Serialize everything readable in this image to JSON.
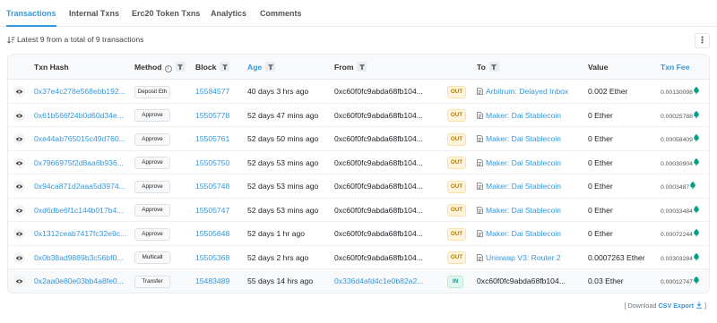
{
  "tabs": [
    {
      "label": "Transactions",
      "active": true
    },
    {
      "label": "Internal Txns"
    },
    {
      "label": "Erc20 Token Txns"
    },
    {
      "label": "Analytics"
    },
    {
      "label": "Comments"
    }
  ],
  "summary": "Latest 9 from a total of 9 transactions",
  "more_icon": "⋮",
  "columns": {
    "txn_hash": "Txn Hash",
    "method": "Method",
    "block": "Block",
    "age": "Age",
    "from": "From",
    "to": "To",
    "value": "Value",
    "txn_fee": "Txn Fee"
  },
  "rows": [
    {
      "hash": "0x37e4c278e568ebb192...",
      "method": "Deposit Eth",
      "block": "15584577",
      "age": "40 days 3 hrs ago",
      "from": "0xc60f0fc9abda68fb104...",
      "direction": "OUT",
      "to": "Arbitrum: Delayed Inbox",
      "to_is_contract": true,
      "value": "0.002 Ether",
      "fee": "0.00130098"
    },
    {
      "hash": "0x61b566f24b0d60d34e...",
      "method": "Approve",
      "block": "15505778",
      "age": "52 days 47 mins ago",
      "from": "0xc60f0fc9abda68fb104...",
      "direction": "OUT",
      "to": "Maker: Dai Stablecoin",
      "to_is_contract": true,
      "value": "0 Ether",
      "fee": "0.00025788"
    },
    {
      "hash": "0xe44ab765015c49d760...",
      "method": "Approve",
      "block": "15505761",
      "age": "52 days 50 mins ago",
      "from": "0xc60f0fc9abda68fb104...",
      "direction": "OUT",
      "to": "Maker: Dai Stablecoin",
      "to_is_contract": true,
      "value": "0 Ether",
      "fee": "0.00058409"
    },
    {
      "hash": "0x7966975f2d8aa6b936...",
      "method": "Approve",
      "block": "15505750",
      "age": "52 days 53 mins ago",
      "from": "0xc60f0fc9abda68fb104...",
      "direction": "OUT",
      "to": "Maker: Dai Stablecoin",
      "to_is_contract": true,
      "value": "0 Ether",
      "fee": "0.00030904"
    },
    {
      "hash": "0x94ca871d2aaa5d3974...",
      "method": "Approve",
      "block": "15505748",
      "age": "52 days 53 mins ago",
      "from": "0xc60f0fc9abda68fb104...",
      "direction": "OUT",
      "to": "Maker: Dai Stablecoin",
      "to_is_contract": true,
      "value": "0 Ether",
      "fee": "0.0003487"
    },
    {
      "hash": "0xd6dbe6f1c144b017b4...",
      "method": "Approve",
      "block": "15505747",
      "age": "52 days 53 mins ago",
      "from": "0xc60f0fc9abda68fb104...",
      "direction": "OUT",
      "to": "Maker: Dai Stablecoin",
      "to_is_contract": true,
      "value": "0 Ether",
      "fee": "0.00033484"
    },
    {
      "hash": "0x1312ceab7417fc32e9c...",
      "method": "Approve",
      "block": "15505648",
      "age": "52 days 1 hr ago",
      "from": "0xc60f0fc9abda68fb104...",
      "direction": "OUT",
      "to": "Maker: Dai Stablecoin",
      "to_is_contract": true,
      "value": "0 Ether",
      "fee": "0.00072244"
    },
    {
      "hash": "0x0b38ad9889b3c56bf0...",
      "method": "Multicall",
      "block": "15505368",
      "age": "52 days 2 hrs ago",
      "from": "0xc60f0fc9abda68fb104...",
      "direction": "OUT",
      "to": "Uniswap V3: Router 2",
      "to_is_contract": true,
      "value": "0.0007263 Ether",
      "fee": "0.00303284"
    },
    {
      "hash": "0x2aa0e80e03bb4a8fe0...",
      "method": "Transfer",
      "block": "15483489",
      "age": "55 days 14 hrs ago",
      "from": "0x336d4afd4c1e0b82a2...",
      "from_is_link": true,
      "direction": "IN",
      "to": "0xc60f0fc9abda68fb104...",
      "to_is_contract": false,
      "value": "0.03 Ether",
      "fee": "0.00012747"
    }
  ],
  "footer": {
    "prefix": "[ Download",
    "link": "CSV Export",
    "suffix": "]"
  },
  "colors": {
    "accent": "#3498db",
    "out_badge": "#b47d00",
    "in_badge": "#00a186",
    "gas_icon": "#00a186"
  }
}
